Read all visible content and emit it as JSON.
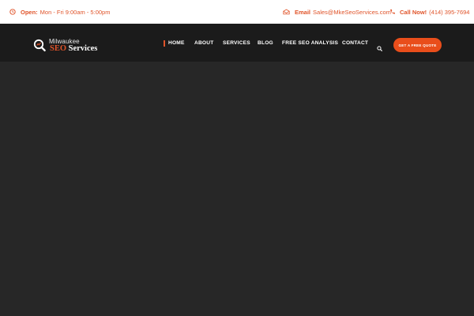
{
  "topbar": {
    "hours_label": "Open:",
    "hours_value": "Mon - Fri 9:00am - 5:00pm",
    "email_label": "Email",
    "email_value": "Sales@MkeSeoServices.com",
    "call_label": "Call Now!",
    "call_value": "(414) 395-7694",
    "icons": [
      "clock-icon",
      "envelope-icon",
      "phone-icon"
    ]
  },
  "logo": {
    "line1": "Milwaukee",
    "line2_a": "SEO",
    "line2_b": "Services"
  },
  "nav": {
    "items": [
      "HOME",
      "ABOUT",
      "SERVICES",
      "BLOG",
      "FREE SEO ANALYSIS",
      "CONTACT"
    ],
    "active": "HOME",
    "cta": "GET A FREE QUOTE"
  },
  "colors": {
    "accent": "#e0542a",
    "cta_bg": "#e94e1b",
    "header_bg": "#1b1b1b",
    "hero_bg": "#272727",
    "topbar_bg": "#ffffff"
  }
}
